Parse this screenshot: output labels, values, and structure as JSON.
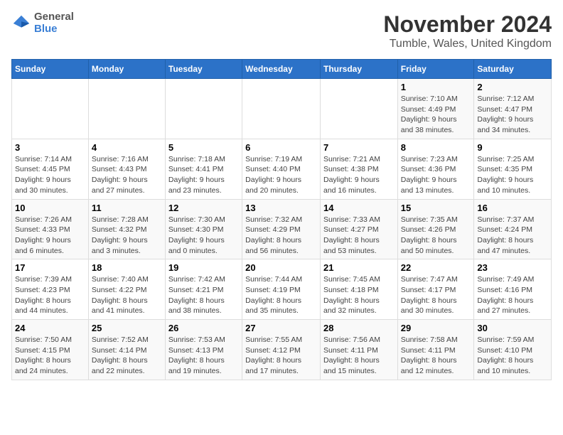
{
  "logo": {
    "line1": "General",
    "line2": "Blue"
  },
  "title": "November 2024",
  "subtitle": "Tumble, Wales, United Kingdom",
  "header": {
    "accent_color": "#2c72c8"
  },
  "weekdays": [
    "Sunday",
    "Monday",
    "Tuesday",
    "Wednesday",
    "Thursday",
    "Friday",
    "Saturday"
  ],
  "weeks": [
    [
      {
        "day": "",
        "info": ""
      },
      {
        "day": "",
        "info": ""
      },
      {
        "day": "",
        "info": ""
      },
      {
        "day": "",
        "info": ""
      },
      {
        "day": "",
        "info": ""
      },
      {
        "day": "1",
        "info": "Sunrise: 7:10 AM\nSunset: 4:49 PM\nDaylight: 9 hours\nand 38 minutes."
      },
      {
        "day": "2",
        "info": "Sunrise: 7:12 AM\nSunset: 4:47 PM\nDaylight: 9 hours\nand 34 minutes."
      }
    ],
    [
      {
        "day": "3",
        "info": "Sunrise: 7:14 AM\nSunset: 4:45 PM\nDaylight: 9 hours\nand 30 minutes."
      },
      {
        "day": "4",
        "info": "Sunrise: 7:16 AM\nSunset: 4:43 PM\nDaylight: 9 hours\nand 27 minutes."
      },
      {
        "day": "5",
        "info": "Sunrise: 7:18 AM\nSunset: 4:41 PM\nDaylight: 9 hours\nand 23 minutes."
      },
      {
        "day": "6",
        "info": "Sunrise: 7:19 AM\nSunset: 4:40 PM\nDaylight: 9 hours\nand 20 minutes."
      },
      {
        "day": "7",
        "info": "Sunrise: 7:21 AM\nSunset: 4:38 PM\nDaylight: 9 hours\nand 16 minutes."
      },
      {
        "day": "8",
        "info": "Sunrise: 7:23 AM\nSunset: 4:36 PM\nDaylight: 9 hours\nand 13 minutes."
      },
      {
        "day": "9",
        "info": "Sunrise: 7:25 AM\nSunset: 4:35 PM\nDaylight: 9 hours\nand 10 minutes."
      }
    ],
    [
      {
        "day": "10",
        "info": "Sunrise: 7:26 AM\nSunset: 4:33 PM\nDaylight: 9 hours\nand 6 minutes."
      },
      {
        "day": "11",
        "info": "Sunrise: 7:28 AM\nSunset: 4:32 PM\nDaylight: 9 hours\nand 3 minutes."
      },
      {
        "day": "12",
        "info": "Sunrise: 7:30 AM\nSunset: 4:30 PM\nDaylight: 9 hours\nand 0 minutes."
      },
      {
        "day": "13",
        "info": "Sunrise: 7:32 AM\nSunset: 4:29 PM\nDaylight: 8 hours\nand 56 minutes."
      },
      {
        "day": "14",
        "info": "Sunrise: 7:33 AM\nSunset: 4:27 PM\nDaylight: 8 hours\nand 53 minutes."
      },
      {
        "day": "15",
        "info": "Sunrise: 7:35 AM\nSunset: 4:26 PM\nDaylight: 8 hours\nand 50 minutes."
      },
      {
        "day": "16",
        "info": "Sunrise: 7:37 AM\nSunset: 4:24 PM\nDaylight: 8 hours\nand 47 minutes."
      }
    ],
    [
      {
        "day": "17",
        "info": "Sunrise: 7:39 AM\nSunset: 4:23 PM\nDaylight: 8 hours\nand 44 minutes."
      },
      {
        "day": "18",
        "info": "Sunrise: 7:40 AM\nSunset: 4:22 PM\nDaylight: 8 hours\nand 41 minutes."
      },
      {
        "day": "19",
        "info": "Sunrise: 7:42 AM\nSunset: 4:21 PM\nDaylight: 8 hours\nand 38 minutes."
      },
      {
        "day": "20",
        "info": "Sunrise: 7:44 AM\nSunset: 4:19 PM\nDaylight: 8 hours\nand 35 minutes."
      },
      {
        "day": "21",
        "info": "Sunrise: 7:45 AM\nSunset: 4:18 PM\nDaylight: 8 hours\nand 32 minutes."
      },
      {
        "day": "22",
        "info": "Sunrise: 7:47 AM\nSunset: 4:17 PM\nDaylight: 8 hours\nand 30 minutes."
      },
      {
        "day": "23",
        "info": "Sunrise: 7:49 AM\nSunset: 4:16 PM\nDaylight: 8 hours\nand 27 minutes."
      }
    ],
    [
      {
        "day": "24",
        "info": "Sunrise: 7:50 AM\nSunset: 4:15 PM\nDaylight: 8 hours\nand 24 minutes."
      },
      {
        "day": "25",
        "info": "Sunrise: 7:52 AM\nSunset: 4:14 PM\nDaylight: 8 hours\nand 22 minutes."
      },
      {
        "day": "26",
        "info": "Sunrise: 7:53 AM\nSunset: 4:13 PM\nDaylight: 8 hours\nand 19 minutes."
      },
      {
        "day": "27",
        "info": "Sunrise: 7:55 AM\nSunset: 4:12 PM\nDaylight: 8 hours\nand 17 minutes."
      },
      {
        "day": "28",
        "info": "Sunrise: 7:56 AM\nSunset: 4:11 PM\nDaylight: 8 hours\nand 15 minutes."
      },
      {
        "day": "29",
        "info": "Sunrise: 7:58 AM\nSunset: 4:11 PM\nDaylight: 8 hours\nand 12 minutes."
      },
      {
        "day": "30",
        "info": "Sunrise: 7:59 AM\nSunset: 4:10 PM\nDaylight: 8 hours\nand 10 minutes."
      }
    ]
  ]
}
